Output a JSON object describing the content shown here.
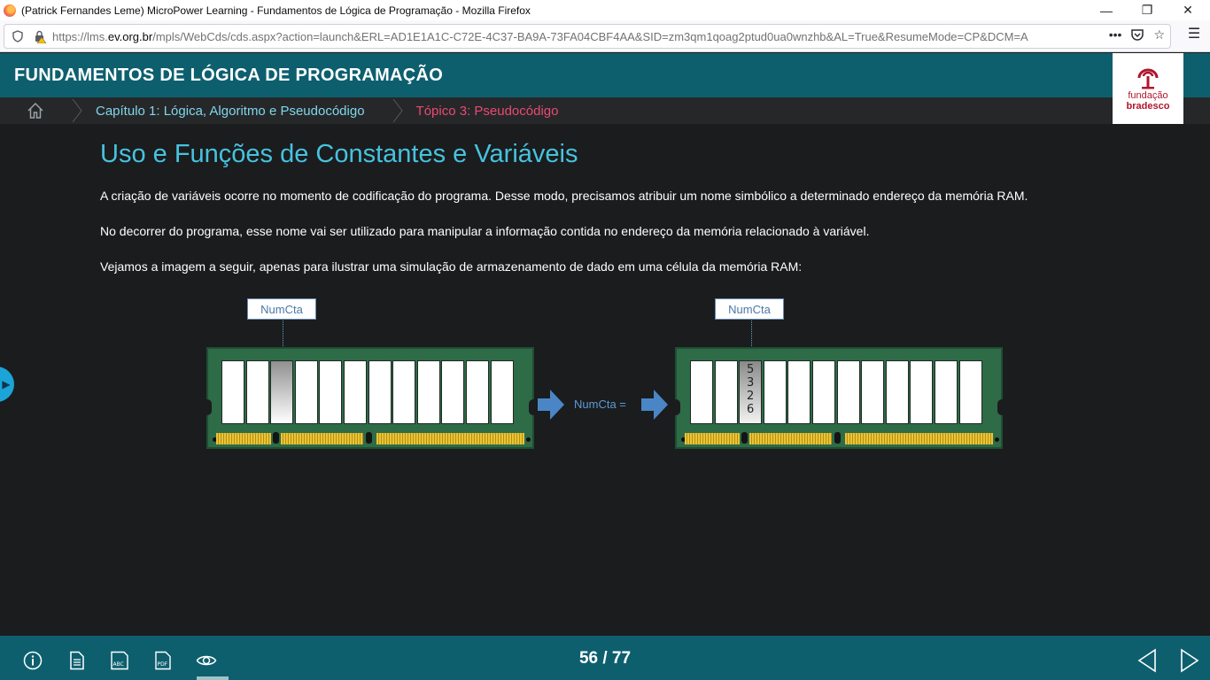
{
  "window": {
    "title": "(Patrick Fernandes Leme) MicroPower Learning - Fundamentos de Lógica de Programação - Mozilla Firefox"
  },
  "browser": {
    "url_prefix": "https://lms.",
    "url_domain": "ev.org.br",
    "url_rest": "/mpls/WebCds/cds.aspx?action=launch&ERL=AD1E1A1C-C72E-4C37-BA9A-73FA04CBF4AA&SID=zm3qm1qoag2ptud0ua0wnzhb&AL=True&ResumeMode=CP&DCM=A"
  },
  "course": {
    "title": "FUNDAMENTOS DE LÓGICA DE PROGRAMAÇÃO",
    "logo_line1": "fundação",
    "logo_line2": "bradesco"
  },
  "breadcrumb": {
    "chapter": "Capítulo 1: Lógica, Algoritmo e Pseudocódigo",
    "topic": "Tópico 3: Pseudocódigo"
  },
  "content": {
    "heading": "Uso e Funções de Constantes e Variáveis",
    "paragraphs": [
      "A criação de variáveis ocorre no momento de codificação do programa. Desse modo, precisamos atribuir um nome simbólico a determinado endereço da memória RAM.",
      "No decorrer do programa, esse nome vai ser utilizado para manipular a informação contida no endereço da memória relacionado à variável.",
      "Vejamos a imagem a seguir, apenas para ilustrar uma simulação de armazenamento de dado em uma célula da memória RAM:"
    ]
  },
  "diagram": {
    "label_left": "NumCta",
    "label_right": "NumCta",
    "assignment": "NumCta =",
    "stored_digits": [
      "5",
      "3",
      "2",
      "6"
    ]
  },
  "footer": {
    "page_counter": "56 / 77",
    "icons": [
      "info-icon",
      "document-icon",
      "glossary-icon",
      "pdf-icon",
      "eye-icon",
      "previous-icon",
      "next-icon"
    ]
  },
  "colors": {
    "header": "#0d5f6e",
    "heading": "#46c3de",
    "chapter_link": "#7fd7ea",
    "topic_link": "#e94a72",
    "brand_red": "#b0162c"
  }
}
